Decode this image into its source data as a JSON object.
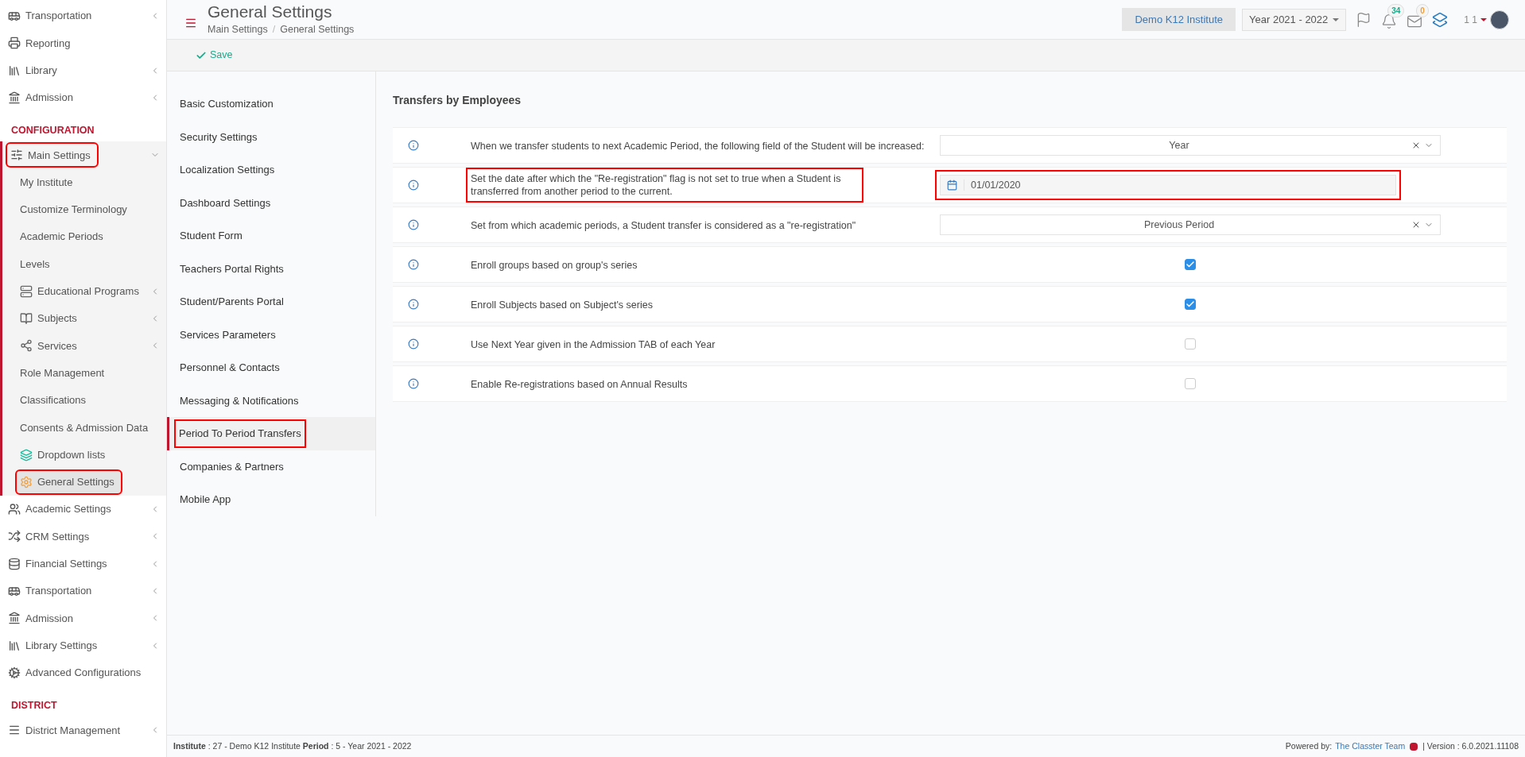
{
  "sidebar": {
    "sections": [
      {
        "items": [
          {
            "label": "Transportation",
            "expanded": false,
            "highlighted": false,
            "selected": false
          },
          {
            "label": "Reporting",
            "highlighted": false,
            "selected": false
          },
          {
            "label": "Library",
            "expanded": false,
            "highlighted": false,
            "selected": false
          },
          {
            "label": "Admission",
            "expanded": false,
            "highlighted": false,
            "selected": false
          }
        ]
      },
      {
        "heading": "CONFIGURATION",
        "items": [
          {
            "label": "Main Settings",
            "expanded": true,
            "highlighted": true,
            "selected": false,
            "children": [
              {
                "label": "My Institute",
                "highlighted": false,
                "selected": false
              },
              {
                "label": "Customize Terminology",
                "highlighted": false,
                "selected": false
              },
              {
                "label": "Academic Periods",
                "highlighted": false,
                "selected": false
              },
              {
                "label": "Levels",
                "highlighted": false,
                "selected": false
              },
              {
                "label": "Educational Programs",
                "expanded": false,
                "highlighted": false,
                "selected": false
              },
              {
                "label": "Subjects",
                "expanded": false,
                "highlighted": false,
                "selected": false
              },
              {
                "label": "Services",
                "expanded": false,
                "highlighted": false,
                "selected": false
              },
              {
                "label": "Role Management",
                "highlighted": false,
                "selected": false
              },
              {
                "label": "Classifications",
                "highlighted": false,
                "selected": false
              },
              {
                "label": "Consents & Admission Data",
                "highlighted": false,
                "selected": false
              },
              {
                "label": "Dropdown lists",
                "highlighted": false,
                "selected": false
              },
              {
                "label": "General Settings",
                "highlighted": true,
                "selected": true
              }
            ]
          },
          {
            "label": "Academic Settings",
            "expanded": false,
            "highlighted": false,
            "selected": false
          },
          {
            "label": "CRM Settings",
            "expanded": false,
            "highlighted": false,
            "selected": false
          },
          {
            "label": "Financial Settings",
            "expanded": false,
            "highlighted": false,
            "selected": false
          },
          {
            "label": "Transportation",
            "expanded": false,
            "highlighted": false,
            "selected": false
          },
          {
            "label": "Admission",
            "expanded": false,
            "highlighted": false,
            "selected": false
          },
          {
            "label": "Library Settings",
            "expanded": false,
            "highlighted": false,
            "selected": false
          },
          {
            "label": "Advanced Configurations",
            "highlighted": false,
            "selected": false
          }
        ]
      },
      {
        "heading": "DISTRICT",
        "items": [
          {
            "label": "District Management",
            "expanded": false,
            "highlighted": false,
            "selected": false
          }
        ]
      }
    ]
  },
  "header": {
    "title": "General Settings",
    "breadcrumb": [
      "Main Settings",
      "General Settings"
    ],
    "breadcrumb_separator": "/",
    "institute": "Demo K12 Institute",
    "year": "Year 2021 - 2022",
    "notifications": "34",
    "messages": "0",
    "user": "1 1"
  },
  "toolbar": {
    "save": "Save"
  },
  "settings_menu": [
    {
      "label": "Basic Customization",
      "selected": false,
      "highlighted": false
    },
    {
      "label": "Security Settings",
      "selected": false,
      "highlighted": false
    },
    {
      "label": "Localization Settings",
      "selected": false,
      "highlighted": false
    },
    {
      "label": "Dashboard Settings",
      "selected": false,
      "highlighted": false
    },
    {
      "label": "Student Form",
      "selected": false,
      "highlighted": false
    },
    {
      "label": "Teachers Portal Rights",
      "selected": false,
      "highlighted": false
    },
    {
      "label": "Student/Parents Portal",
      "selected": false,
      "highlighted": false
    },
    {
      "label": "Services Parameters",
      "selected": false,
      "highlighted": false
    },
    {
      "label": "Personnel & Contacts",
      "selected": false,
      "highlighted": false
    },
    {
      "label": "Messaging & Notifications",
      "selected": false,
      "highlighted": false
    },
    {
      "label": "Period To Period Transfers",
      "selected": true,
      "highlighted": true
    },
    {
      "label": "Companies & Partners",
      "selected": false,
      "highlighted": false
    },
    {
      "label": "Mobile App",
      "selected": false,
      "highlighted": false
    }
  ],
  "section": {
    "title": "Transfers by Employees",
    "rows": [
      {
        "kind": "select",
        "label": "When we transfer students to next Academic Period, the following field of the Student will be increased:",
        "value": "Year",
        "highlighted": false
      },
      {
        "kind": "date",
        "label": "Set the date after which the \"Re-registration\" flag is not set to true when a Student is transferred from another period to the current.",
        "value": "01/01/2020",
        "highlighted": true
      },
      {
        "kind": "select",
        "label": "Set from which academic periods, a Student transfer is considered as a \"re-registration\"",
        "value": "Previous Period",
        "highlighted": false
      },
      {
        "kind": "checkbox",
        "label": "Enroll groups based on group's series",
        "checked": true,
        "highlighted": false
      },
      {
        "kind": "checkbox",
        "label": "Enroll Subjects based on Subject's series",
        "checked": true,
        "highlighted": false
      },
      {
        "kind": "checkbox",
        "label": "Use Next Year given in the Admission TAB of each Year",
        "checked": false,
        "highlighted": false
      },
      {
        "kind": "checkbox",
        "label": "Enable Re-registrations based on Annual Results",
        "checked": false,
        "highlighted": false
      }
    ]
  },
  "footer": {
    "info": "**Institute** : 27 - Demo K12 Institute **Period** : 5 - Year 2021 - 2022",
    "powered_by": "Powered by:",
    "team": "The Classter Team",
    "version": "| Version : 6.0.2021.11108"
  }
}
